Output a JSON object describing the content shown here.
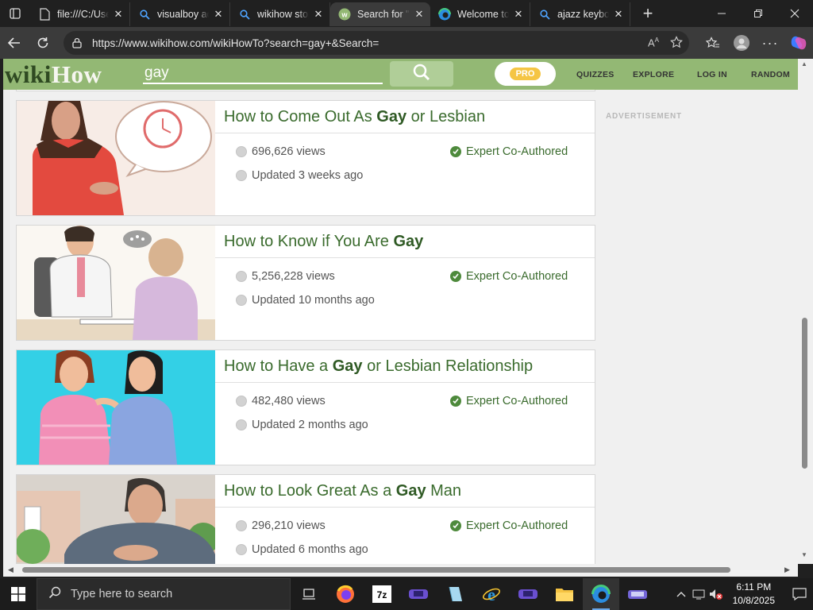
{
  "browser": {
    "tabs": [
      {
        "title": "file:///C:/Users",
        "icon": "file-icon"
      },
      {
        "title": "visualboy adv",
        "icon": "search-icon"
      },
      {
        "title": "wikihow stop",
        "icon": "search-icon"
      },
      {
        "title": "Search for \"g",
        "icon": "wikihow-icon",
        "active": true
      },
      {
        "title": "Welcome to",
        "icon": "edge-icon"
      },
      {
        "title": "ajazz keyboard",
        "icon": "search-icon"
      }
    ],
    "url": "https://www.wikihow.com/wikiHowTo?search=gay+&Search="
  },
  "header": {
    "logo_wiki": "wiki",
    "logo_how": "How",
    "search_value": "gay",
    "pro_label": "PRO",
    "nav": [
      "QUIZZES",
      "EXPLORE",
      "LOG IN",
      "RANDOM"
    ]
  },
  "advertisement": "ADVERTISEMENT",
  "results": [
    {
      "title_pre": "How to Come Out As ",
      "title_bold": "Gay",
      "title_post": " or Lesbian",
      "views": "696,626 views",
      "updated": "Updated 3 weeks ago",
      "badge": "Expert Co-Authored"
    },
    {
      "title_pre": "How to Know if You Are ",
      "title_bold": "Gay",
      "title_post": "",
      "views": "5,256,228 views",
      "updated": "Updated 10 months ago",
      "badge": "Expert Co-Authored"
    },
    {
      "title_pre": "How to Have a ",
      "title_bold": "Gay",
      "title_post": " or Lesbian Relationship",
      "views": "482,480 views",
      "updated": "Updated 2 months ago",
      "badge": "Expert Co-Authored"
    },
    {
      "title_pre": "How to Look Great As a ",
      "title_bold": "Gay",
      "title_post": " Man",
      "views": "296,210 views",
      "updated": "Updated 6 months ago",
      "badge": "Expert Co-Authored"
    }
  ],
  "taskbar": {
    "search_placeholder": "Type here to search",
    "time": "6:11 PM",
    "date": "10/8/2025",
    "apps": [
      "task-view-icon",
      "firefox-icon",
      "7zip-icon",
      "gameboy-icon",
      "notepad-icon",
      "ie-icon",
      "gameboy-icon",
      "file-explorer-icon",
      "edge-icon",
      "gamepad-icon"
    ]
  }
}
